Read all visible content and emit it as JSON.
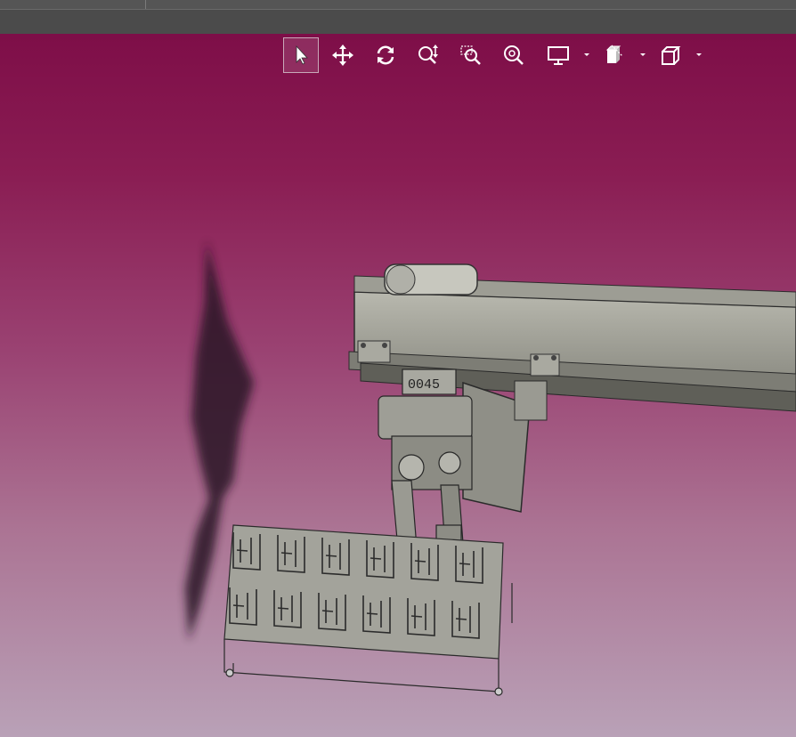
{
  "window": {
    "title_bar": "",
    "tab_bar": ""
  },
  "toolbar": {
    "tools": [
      {
        "name": "select",
        "icon": "arrow-cursor-icon",
        "active": true
      },
      {
        "name": "pan",
        "icon": "move-arrows-icon",
        "active": false
      },
      {
        "name": "rotate",
        "icon": "rotate-icon",
        "active": false
      },
      {
        "name": "zoom",
        "icon": "zoom-updown-icon",
        "active": false
      },
      {
        "name": "zoom-window",
        "icon": "zoom-window-icon",
        "active": false
      },
      {
        "name": "zoom-fit",
        "icon": "zoom-fit-icon",
        "active": false
      },
      {
        "name": "display",
        "icon": "monitor-icon",
        "active": false,
        "dropdown": true
      },
      {
        "name": "section",
        "icon": "section-view-icon",
        "active": false,
        "dropdown": true
      },
      {
        "name": "view-cube",
        "icon": "cube-icon",
        "active": false,
        "dropdown": true
      }
    ]
  },
  "viewport": {
    "background_top": "#7e0e48",
    "background_bottom": "#b9a1b7",
    "model_text": "0045"
  }
}
